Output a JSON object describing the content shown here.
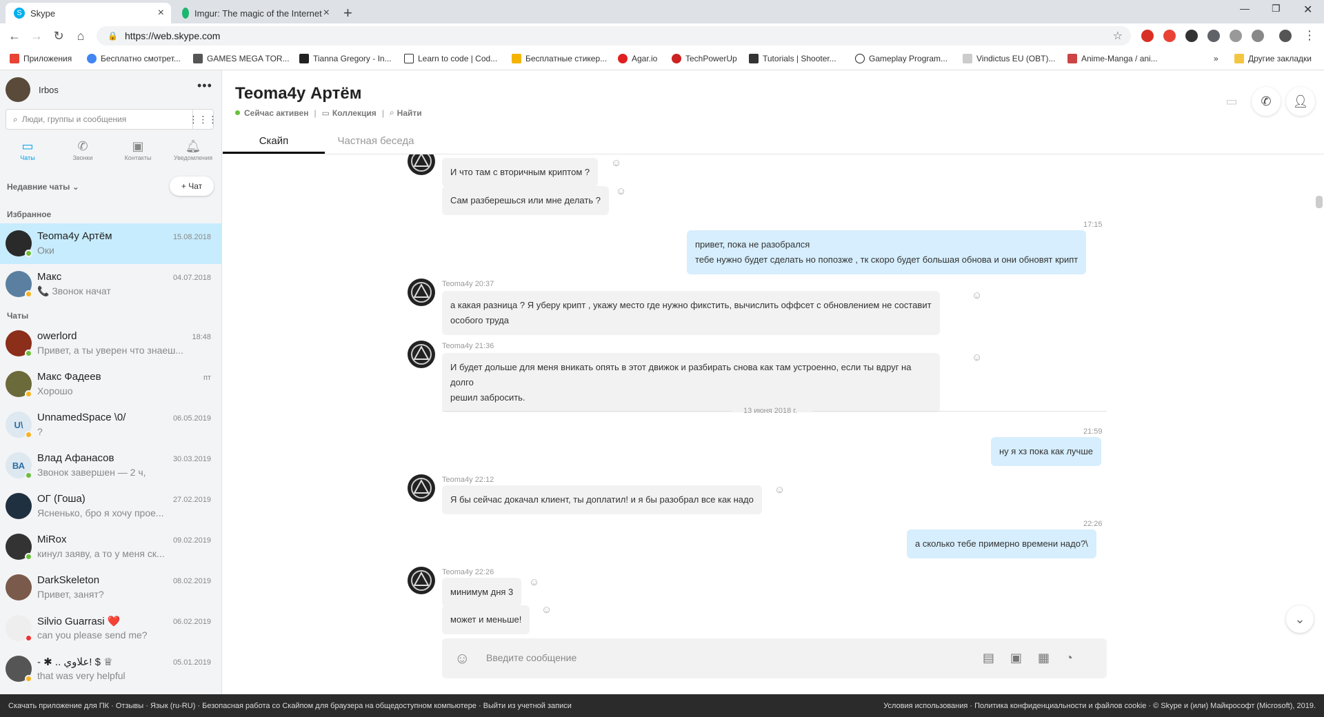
{
  "browser": {
    "tabs": [
      {
        "label": "Skype"
      },
      {
        "label": "Imgur: The magic of the Internet"
      }
    ],
    "url": "https://web.skype.com",
    "bookmarks": [
      {
        "label": "Приложения",
        "color": "#e94235"
      },
      {
        "label": "Бесплатно смотрет...",
        "color": "#4285f4"
      },
      {
        "label": "GAMES MEGA TOR...",
        "color": "#555555"
      },
      {
        "label": "Tianna Gregory - In...",
        "color": "#222222"
      },
      {
        "label": "Learn to code | Cod...",
        "color": "#333333"
      },
      {
        "label": "Бесплатные стикер...",
        "color": "#f4b400"
      },
      {
        "label": "Agar.io",
        "color": "#e02020"
      },
      {
        "label": "TechPowerUp",
        "color": "#cc2222"
      },
      {
        "label": "Tutorials | Shooter...",
        "color": "#333333"
      },
      {
        "label": "Gameplay Program...",
        "color": "#222222"
      },
      {
        "label": "Vindictus EU (OBT)...",
        "color": "#999999"
      },
      {
        "label": "Anime-Manga / ani...",
        "color": "#cc4444"
      },
      {
        "label": "»",
        "color": ""
      },
      {
        "label": "Другие закладки",
        "color": "#f4c542"
      }
    ]
  },
  "sidebar": {
    "user_name": "Irbos",
    "search_placeholder": "Люди, группы и сообщения",
    "nav": [
      {
        "label": "Чаты",
        "icon": "chat-icon"
      },
      {
        "label": "Звонки",
        "icon": "phone-icon"
      },
      {
        "label": "Контакты",
        "icon": "contacts-icon"
      },
      {
        "label": "Уведомления",
        "icon": "bell-icon"
      }
    ],
    "recent_label": "Недавние чаты",
    "new_chat_label": "+ Чат",
    "favorites_label": "Избранное",
    "chats_label": "Чаты",
    "favorites": [
      {
        "name": "Teoma4y Артём",
        "preview": "Оки",
        "date": "15.08.2018",
        "status": "#6bbf3b",
        "avatar_color": "#2a2a2a",
        "initials": ""
      },
      {
        "name": "Макс",
        "preview": "📞 Звонок начат",
        "date": "04.07.2018",
        "status": "#f8b41e",
        "avatar_color": "#5a7fa0",
        "initials": ""
      }
    ],
    "chats": [
      {
        "name": "owerlord",
        "preview": "Привет, а ты уверен что знаеш...",
        "date": "18:48",
        "status": "#6bbf3b",
        "avatar_color": "#8b2e1a",
        "initials": ""
      },
      {
        "name": "Макс Фадеев",
        "preview": "Хорошо",
        "date": "пт",
        "status": "#f8b41e",
        "avatar_color": "#6a6a3a",
        "initials": ""
      },
      {
        "name": "UnnamedSpace \\0/",
        "preview": "?",
        "date": "06.05.2019",
        "status": "#f8b41e",
        "avatar_color": "#dde8f0",
        "initials": "U\\"
      },
      {
        "name": "Влад Афанасов",
        "preview": "Звонок завершен — 2 ч,",
        "date": "30.03.2019",
        "status": "#6bbf3b",
        "avatar_color": "#dde8f0",
        "initials": "ВА"
      },
      {
        "name": "ОГ (Гоша)",
        "preview": "Ясненько, бро я хочу прое...",
        "date": "27.02.2019",
        "status": "",
        "avatar_color": "#1f3040",
        "initials": ""
      },
      {
        "name": "MiRox",
        "preview": "кинул заяву, а то у меня ск...",
        "date": "09.02.2019",
        "status": "#6bbf3b",
        "avatar_color": "#333333",
        "initials": ""
      },
      {
        "name": "DarkSkeleton",
        "preview": "Привет, занят?",
        "date": "08.02.2019",
        "status": "",
        "avatar_color": "#7a5a4a",
        "initials": ""
      },
      {
        "name": "Silvio Guarrasi ❤️",
        "preview": "can you please send me?",
        "date": "06.02.2019",
        "status": "#e33",
        "avatar_color": "#eeeeee",
        "initials": ""
      },
      {
        "name": "- ✱ .. علاوي! $ ♕",
        "preview": "that was very helpful",
        "date": "05.01.2019",
        "status": "#f8b41e",
        "avatar_color": "#555555",
        "initials": ""
      }
    ]
  },
  "conversation": {
    "title": "Teoma4y Артём",
    "status": "Сейчас активен",
    "collection": "Коллекция",
    "find": "Найти",
    "tabs": [
      "Скайп",
      "Частная беседа"
    ],
    "messages": [
      {
        "dir": "in",
        "text": "И что там с вторичным криптом ?",
        "meta": ""
      },
      {
        "dir": "in",
        "text": "Сам разберешься или мне делать ?",
        "meta": ""
      },
      {
        "dir": "out",
        "time": "17:15",
        "lines": [
          "привет, пока не разобрался",
          "тебе нужно будет сделать но попозже , тк скоро будет большая обнова и они обновят крипт"
        ]
      },
      {
        "dir": "in",
        "meta": "Teoma4y 20:37",
        "lines": [
          "а какая разница ? Я уберу крипт , укажу место где нужно фикстить, вычислить оффсет с обновлением не составит",
          "особого труда"
        ]
      },
      {
        "dir": "in",
        "meta": "Teoma4y 21:36",
        "lines": [
          "И будет дольше для меня вникать опять в этот движок и разбирать снова как там устроенно, если ты вдруг на долго",
          "решил забросить."
        ]
      },
      {
        "dir": "sep",
        "text": "13 июня 2018 г."
      },
      {
        "dir": "out",
        "time": "21:59",
        "text": "ну я хз пока как лучше"
      },
      {
        "dir": "in",
        "meta": "Teoma4y 22:12",
        "text": "Я бы сейчас докачал клиент, ты доплатил! и я бы разобрал все как надо"
      },
      {
        "dir": "out",
        "time": "22:26",
        "text": "а сколько тебе примерно времени надо?\\"
      },
      {
        "dir": "in",
        "meta": "Teoma4y 22:26",
        "text": "минимум дня 3"
      },
      {
        "dir": "in",
        "text": "может и меньше!",
        "meta": ""
      }
    ],
    "composer_placeholder": "Введите сообщение"
  },
  "footer": {
    "left": "Скачать приложение для ПК · Отзывы · Язык (ru-RU) · Безопасная работа со Скайпом для браузера на общедоступном компьютере · Выйти из учетной записи",
    "right": "Условия использования · Политика конфиденциальности и файлов cookie · © Skype и (или) Майкрософт (Microsoft), 2019."
  },
  "colors": {
    "accent": "#00a2ed",
    "selected_chat": "#c7ecfd",
    "outgoing_bubble": "#d6eefd",
    "incoming_bubble": "#f2f2f2"
  }
}
